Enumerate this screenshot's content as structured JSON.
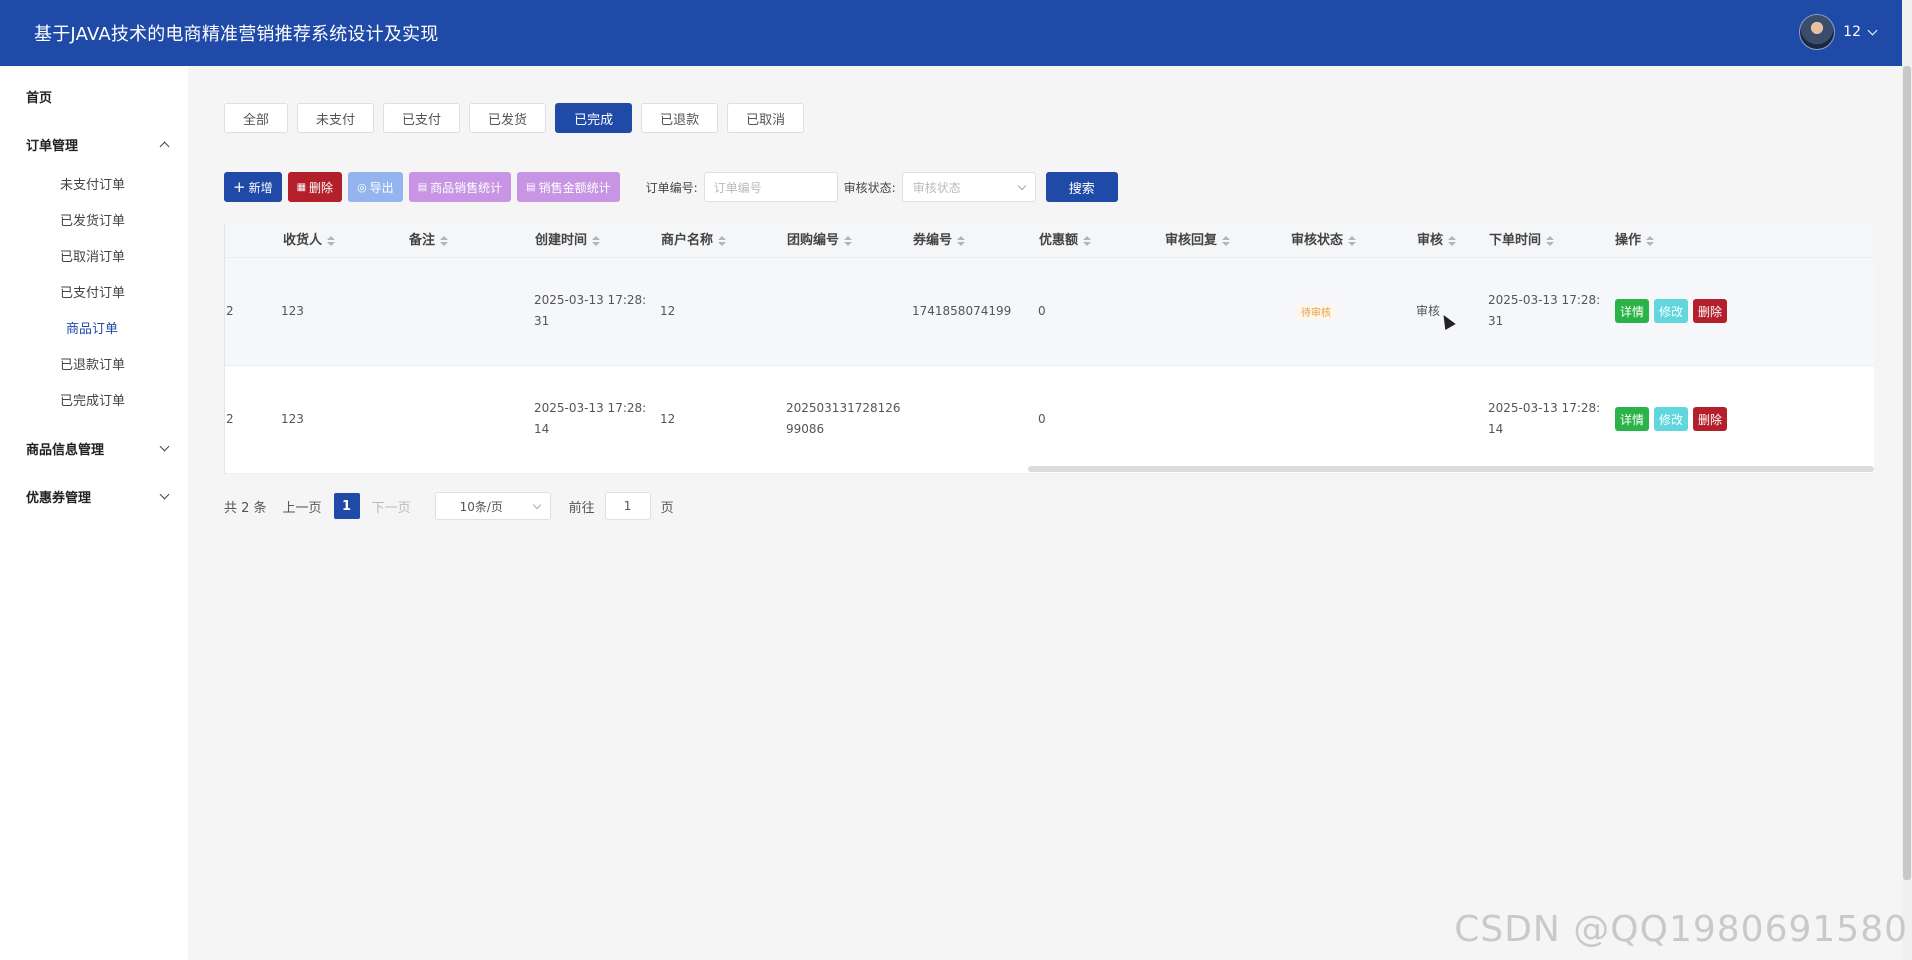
{
  "app": {
    "title": "基于JAVA技术的电商精准营销推荐系统设计及实现"
  },
  "user": {
    "name": "12"
  },
  "sidebar": {
    "home": "首页",
    "order_mgmt": "订单管理",
    "order_items": [
      "未支付订单",
      "已发货订单",
      "已取消订单",
      "已支付订单",
      "商品订单",
      "已退款订单",
      "已完成订单"
    ],
    "product_mgmt": "商品信息管理",
    "coupon_mgmt": "优惠券管理"
  },
  "status_tabs": [
    "全部",
    "未支付",
    "已支付",
    "已发货",
    "已完成",
    "已退款",
    "已取消"
  ],
  "active_tab": "已完成",
  "toolbar": {
    "add": "新增",
    "delete": "删除",
    "export": "导出",
    "sales_stats": "商品销售统计",
    "amount_stats": "销售金额统计",
    "order_no_label": "订单编号:",
    "order_no_placeholder": "订单编号",
    "review_label": "审核状态:",
    "review_placeholder": "审核状态",
    "search": "搜索"
  },
  "table": {
    "headers": [
      "收货人",
      "备注",
      "创建时间",
      "商户名称",
      "团购编号",
      "券编号",
      "优惠额",
      "审核回复",
      "审核状态",
      "审核",
      "下单时间",
      "操作"
    ],
    "rows": [
      {
        "lead": "2",
        "receiver": "123",
        "remark": "",
        "created_1": "2025-03-13 17:28:",
        "created_2": "31",
        "merchant": "12",
        "group_no_1": "",
        "group_no_2": "",
        "coupon_no": "1741858074199",
        "discount": "0",
        "review_reply": "",
        "review_status": "待审核",
        "review": "审核",
        "order_time_1": "2025-03-13 17:28:",
        "order_time_2": "31"
      },
      {
        "lead": "2",
        "receiver": "123",
        "remark": "",
        "created_1": "2025-03-13 17:28:",
        "created_2": "14",
        "merchant": "12",
        "group_no_1": "202503131728126",
        "group_no_2": "99086",
        "coupon_no": "",
        "discount": "0",
        "review_reply": "",
        "review_status": "",
        "review": "",
        "order_time_1": "2025-03-13 17:28:",
        "order_time_2": "14"
      }
    ],
    "ops": {
      "detail": "详情",
      "edit": "修改",
      "delete": "删除"
    }
  },
  "pagination": {
    "total": "共 2 条",
    "prev": "上一页",
    "page": "1",
    "next": "下一页",
    "size": "10条/页",
    "goto": "前往",
    "goto_value": "1",
    "page_unit": "页"
  },
  "watermark": "CSDN @QQ1980691580",
  "colors": {
    "primary": "#1f4aa8",
    "danger": "#b3202b",
    "success": "#2bb349",
    "info": "#5fd7dd",
    "purple": "#c795e3"
  }
}
